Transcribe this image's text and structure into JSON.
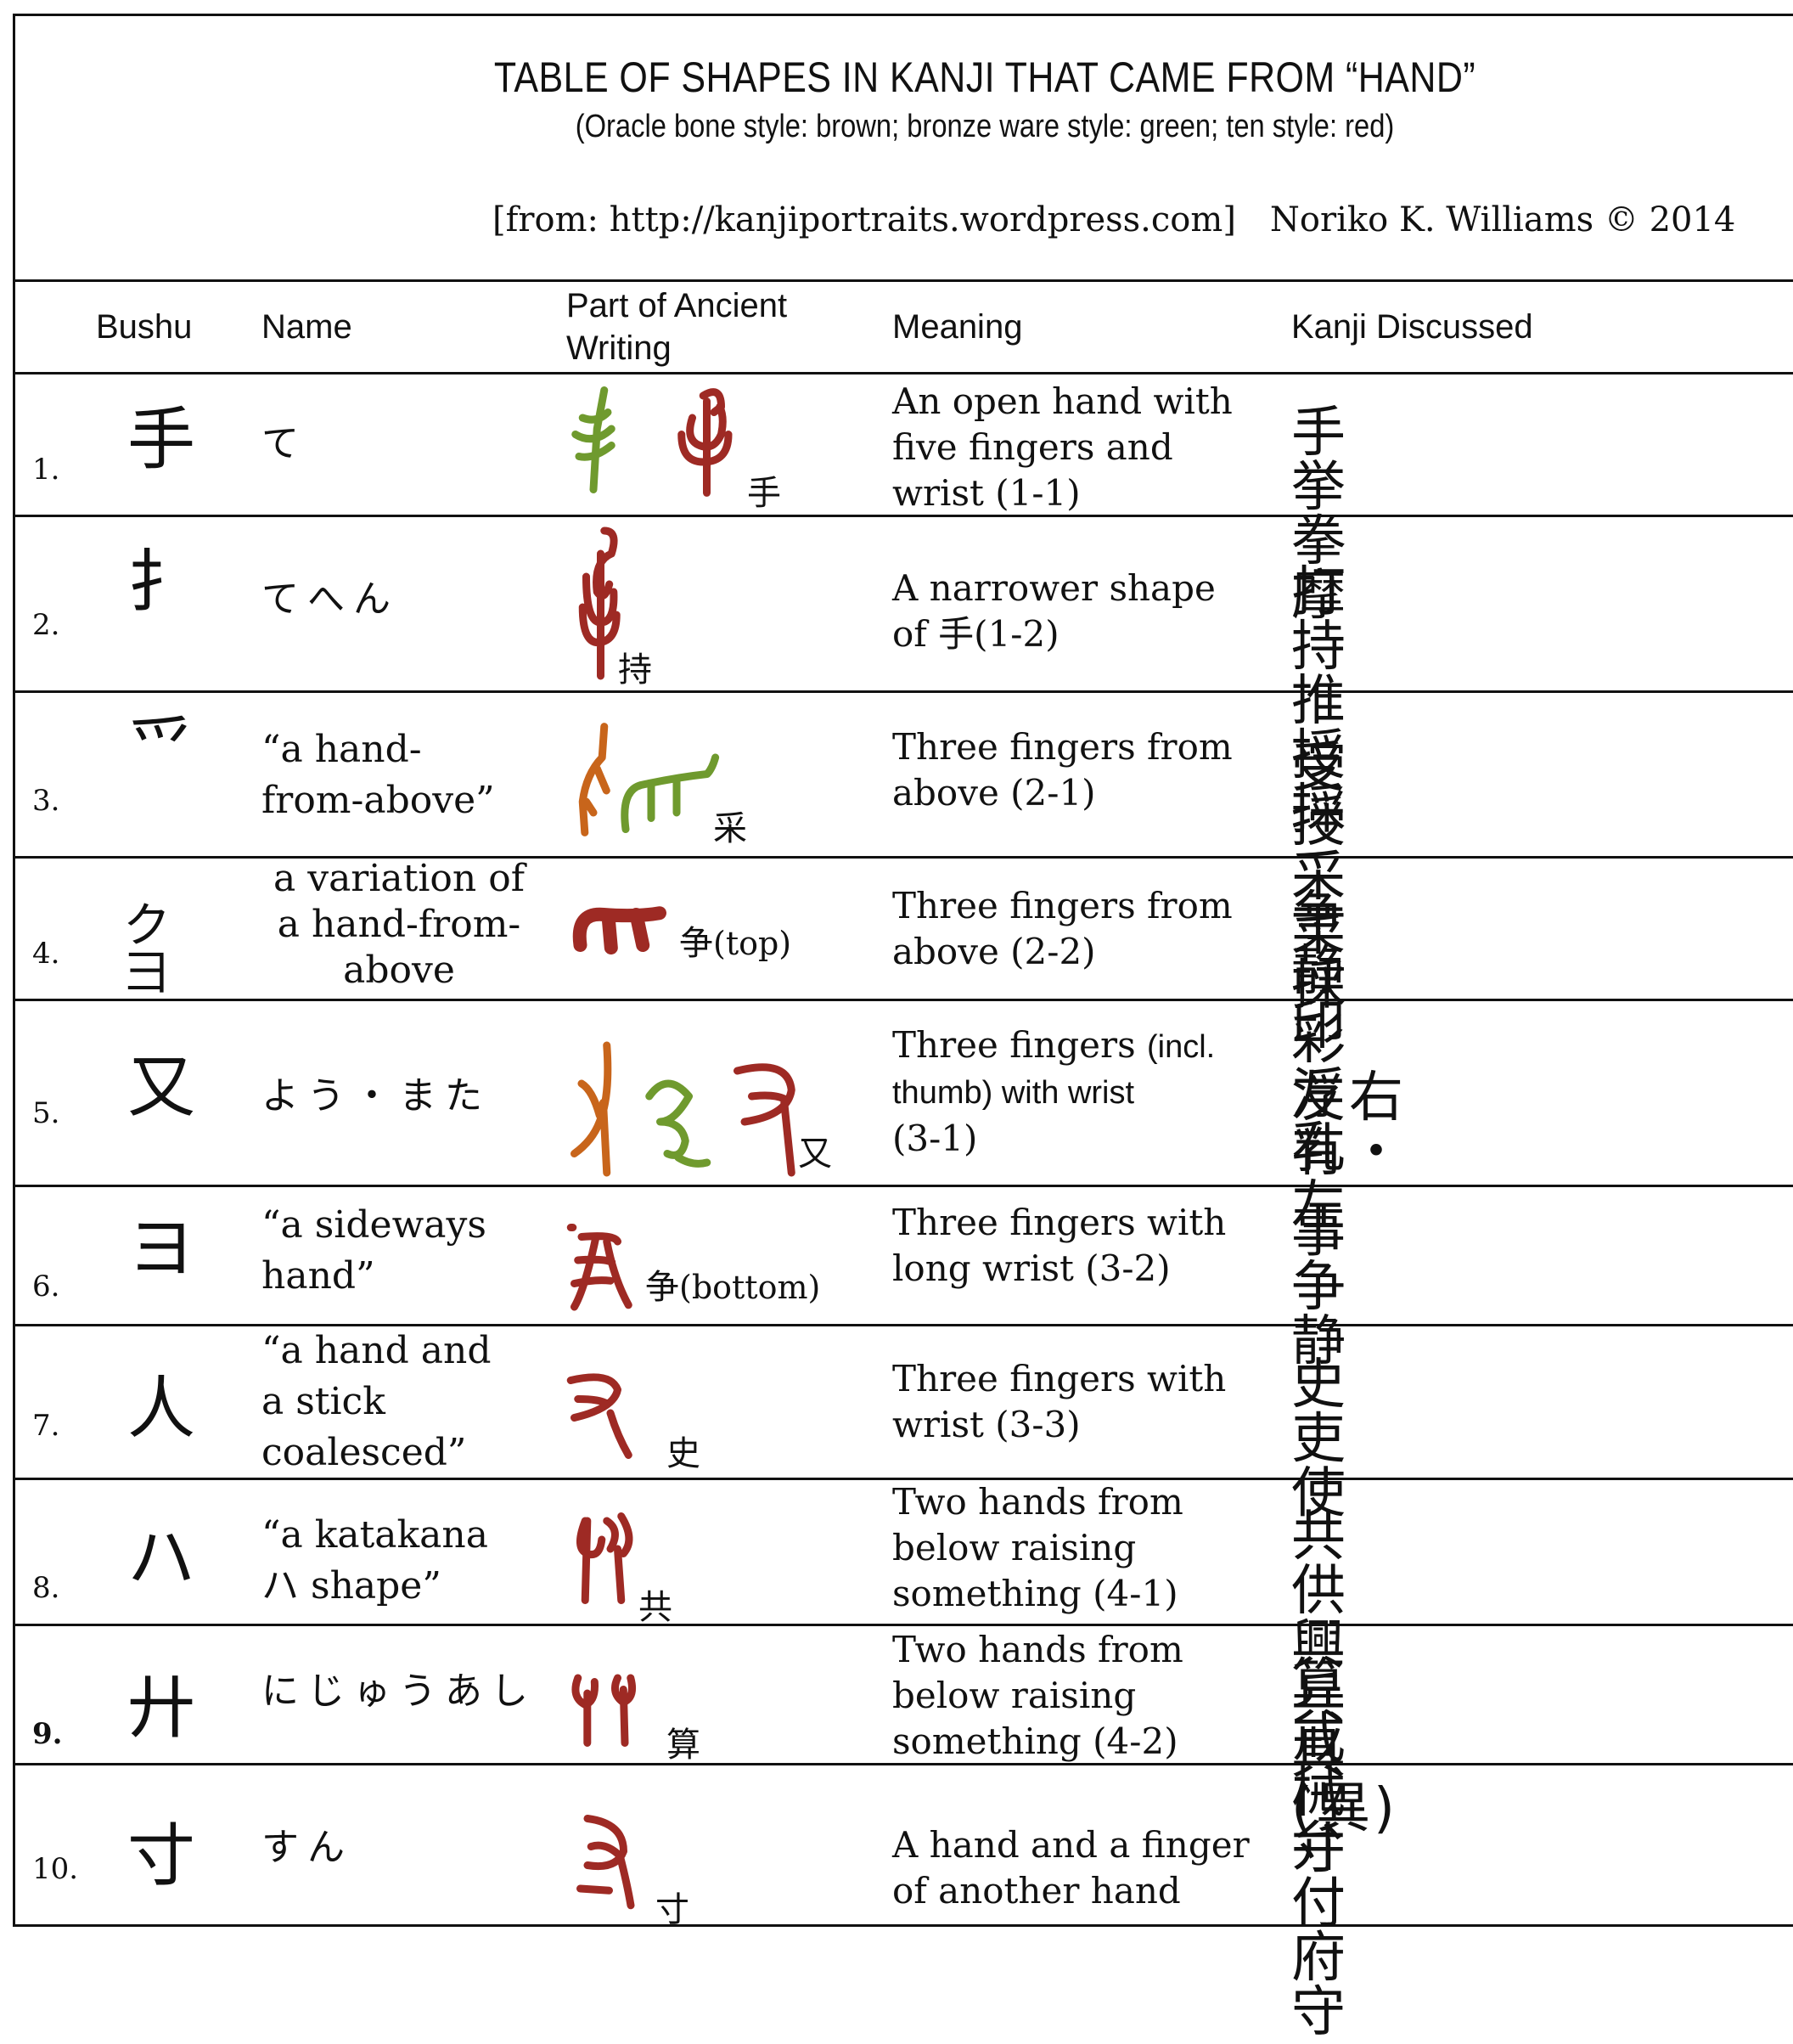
{
  "header": {
    "title": "TABLE OF SHAPES IN KANJI THAT CAME FROM “HAND”",
    "subtitle": "(Oracle bone style: brown; bronze ware style: green; ten style: red)",
    "source": "[from: http://kanjiportraits.wordpress.com]",
    "author": "Noriko K. Williams © 2014"
  },
  "colors": {
    "oracle_bone": "#c8651b",
    "bronze_ware": "#6f9a2e",
    "ten_style": "#9e2a24"
  },
  "columns": {
    "bushu": "Bushu",
    "name": "Name",
    "ancient_line1": "Part of Ancient",
    "ancient_line2": "Writing",
    "meaning": "Meaning",
    "kanji": "Kanji Discussed"
  },
  "rows": [
    {
      "num": "1.",
      "bushu": "手",
      "name": [
        "て"
      ],
      "ancient_styles": [
        "bronze_ware",
        "ten_style"
      ],
      "ancient_label": "手",
      "ancient_note": "",
      "meaning": [
        "An open hand with",
        "five fingers and",
        "wrist (1-1)"
      ],
      "kanji": "手挙拳摩"
    },
    {
      "num": "2.",
      "bushu": "扌",
      "name": [
        "てへん"
      ],
      "ancient_styles": [
        "ten_style"
      ],
      "ancient_label": "持",
      "ancient_note": "",
      "meaning": [
        "A narrower shape",
        "of 手(1-2)"
      ],
      "kanji": "打持推授採"
    },
    {
      "num": "3.",
      "bushu": "⺤",
      "name": [
        "“a hand-",
        "from-above”"
      ],
      "ancient_styles": [
        "oracle_bone",
        "bronze_ware"
      ],
      "ancient_label": "采",
      "ancient_note": "",
      "meaning": [
        "Three fingers from",
        "above (2-1)"
      ],
      "kanji": "受授采菜採彩浮乳"
    },
    {
      "num": "4.",
      "bushu": "ク ⺕",
      "name": [
        "a variation of",
        "a hand-from-",
        "above"
      ],
      "ancient_styles": [
        "ten_style"
      ],
      "ancient_label": "争",
      "ancient_note": "(top)",
      "meaning": [
        "Three fingers from",
        "above (2-2)"
      ],
      "kanji": "争静印"
    },
    {
      "num": "5.",
      "bushu": "又",
      "name": [
        "よう・また"
      ],
      "ancient_styles": [
        "oracle_bone",
        "bronze_ware",
        "ten_style"
      ],
      "ancient_label": "又",
      "ancient_note": "",
      "meaning": [
        "Three fingers",
        "(incl.",
        "thumb) with wrist",
        "(3-1)"
      ],
      "kanji": "友右有・左"
    },
    {
      "num": "6.",
      "bushu": "ヨ",
      "name": [
        "“a sideways",
        "hand”"
      ],
      "ancient_styles": [
        "ten_style"
      ],
      "ancient_label": "争",
      "ancient_note": "(bottom)",
      "meaning": [
        "Three fingers with",
        "long wrist (3-2)"
      ],
      "kanji": "事争静"
    },
    {
      "num": "7.",
      "bushu": "㇏人",
      "name": [
        "“a hand and",
        "a stick",
        "coalesced”"
      ],
      "ancient_styles": [
        "ten_style"
      ],
      "ancient_label": "史",
      "ancient_note": "",
      "meaning": [
        "Three fingers with",
        "wrist (3-3)"
      ],
      "kanji": "史吏使"
    },
    {
      "num": "8.",
      "bushu": "ハ",
      "name": [
        "“a katakana",
        "ハ shape”"
      ],
      "ancient_styles": [
        "ten_style"
      ],
      "ancient_label": "共",
      "ancient_note": "",
      "meaning": [
        "Two hands from",
        "below raising",
        "something (4-1)"
      ],
      "kanji": "共供興兵具(異)"
    },
    {
      "num": "9.",
      "bushu": "廾",
      "name": [
        "にじゅうあし"
      ],
      "ancient_styles": [
        "ten_style"
      ],
      "ancient_label": "算",
      "ancient_note": "",
      "meaning": [
        "Two hands from",
        "below raising",
        "something (4-2)"
      ],
      "kanji": "算戒械弁"
    },
    {
      "num": "10.",
      "bushu": "寸",
      "name": [
        "すん"
      ],
      "ancient_styles": [
        "ten_style"
      ],
      "ancient_label": "寸",
      "ancient_note": "",
      "meaning": [
        "A hand and a finger",
        "of another hand"
      ],
      "kanji": "寸付府守"
    }
  ]
}
